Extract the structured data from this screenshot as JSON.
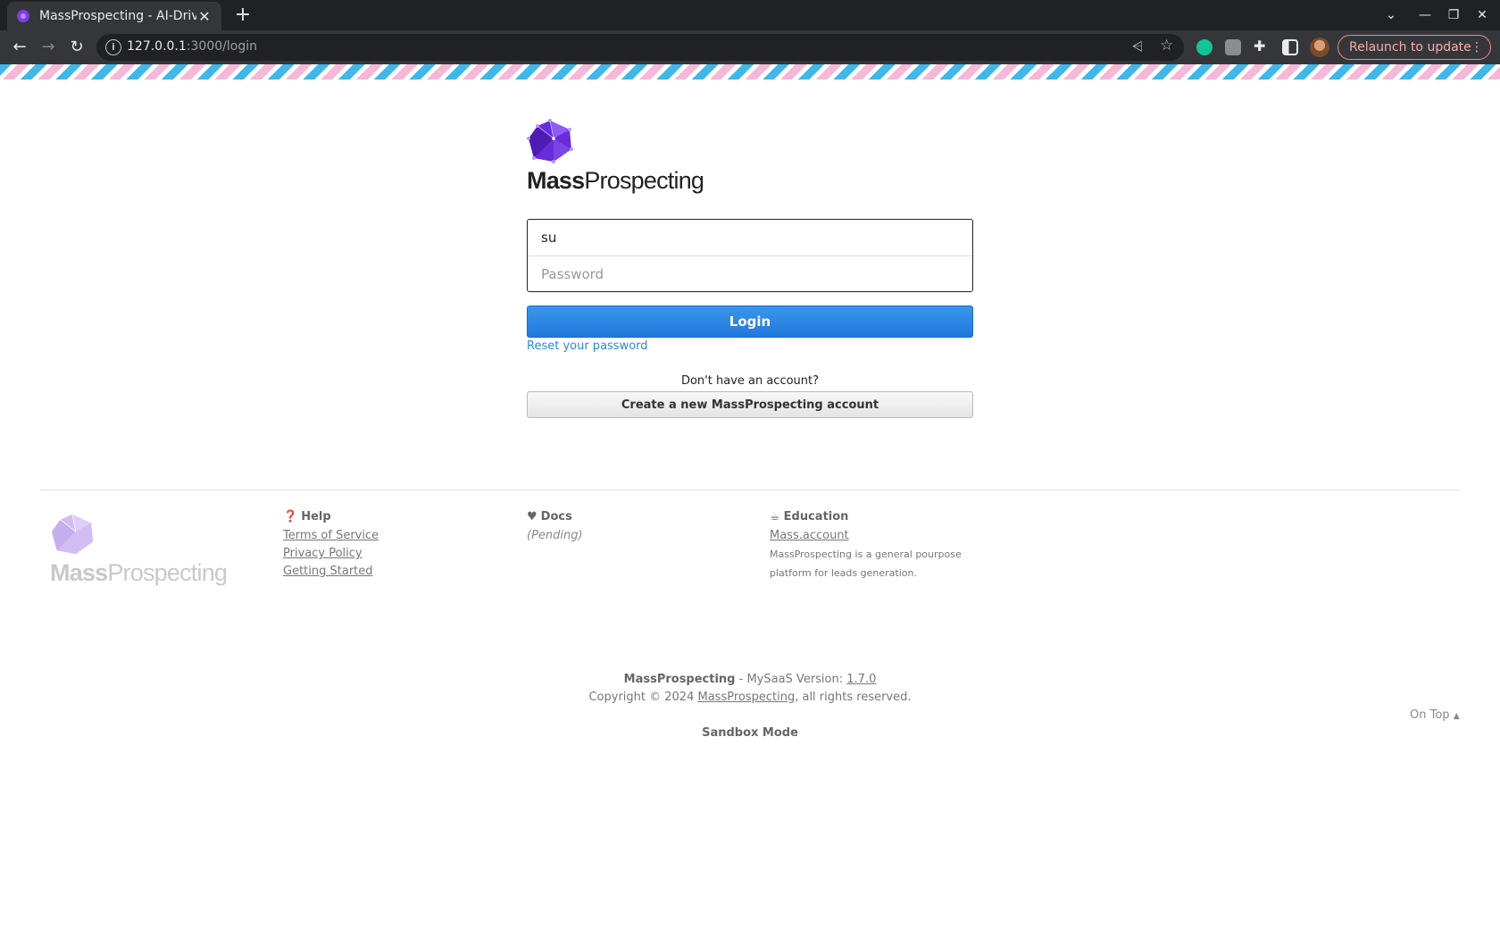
{
  "browser": {
    "tab_title": "MassProspecting - AI-Driv",
    "tab_close": "✕",
    "new_tab": "+",
    "url_host": "127.0.0.1",
    "url_rest": ":3000/login",
    "relaunch_label": "Relaunch to update",
    "window_min": "—",
    "window_restore": "❐",
    "window_close": "✕",
    "tab_search": "⌄"
  },
  "colors": {
    "brand_purple": "#6a2bd9",
    "login_blue": "#2a86e2",
    "link_blue": "#2a8ad0"
  },
  "brand": {
    "name_bold": "Mass",
    "name_rest": "Prospecting"
  },
  "login": {
    "username_value": "su",
    "password_placeholder": "Password",
    "login_label": "Login",
    "reset_label": "Reset your password",
    "no_account_text": "Don't have an account?",
    "create_label": "Create a new MassProspecting account"
  },
  "footer": {
    "help": {
      "title": "Help",
      "icon": "question-circle-icon",
      "links": [
        "Terms of Service",
        "Privacy Policy",
        "Getting Started"
      ]
    },
    "docs": {
      "title": "Docs",
      "icon": "heart-icon",
      "pending": "(Pending)"
    },
    "education": {
      "title": "Education",
      "icon": "book-icon",
      "link": "Mass.account",
      "desc": "MassProspecting is a general pourpose platform for leads generation."
    },
    "version_brand": "MassProspecting",
    "version_text": " - MySaaS Version: ",
    "version_number": "1.7.0",
    "copyright_prefix": "Copyright © 2024 ",
    "copyright_link": "MassProspecting",
    "copyright_suffix": ", all rights reserved.",
    "sandbox": "Sandbox Mode",
    "on_top": "On Top"
  }
}
